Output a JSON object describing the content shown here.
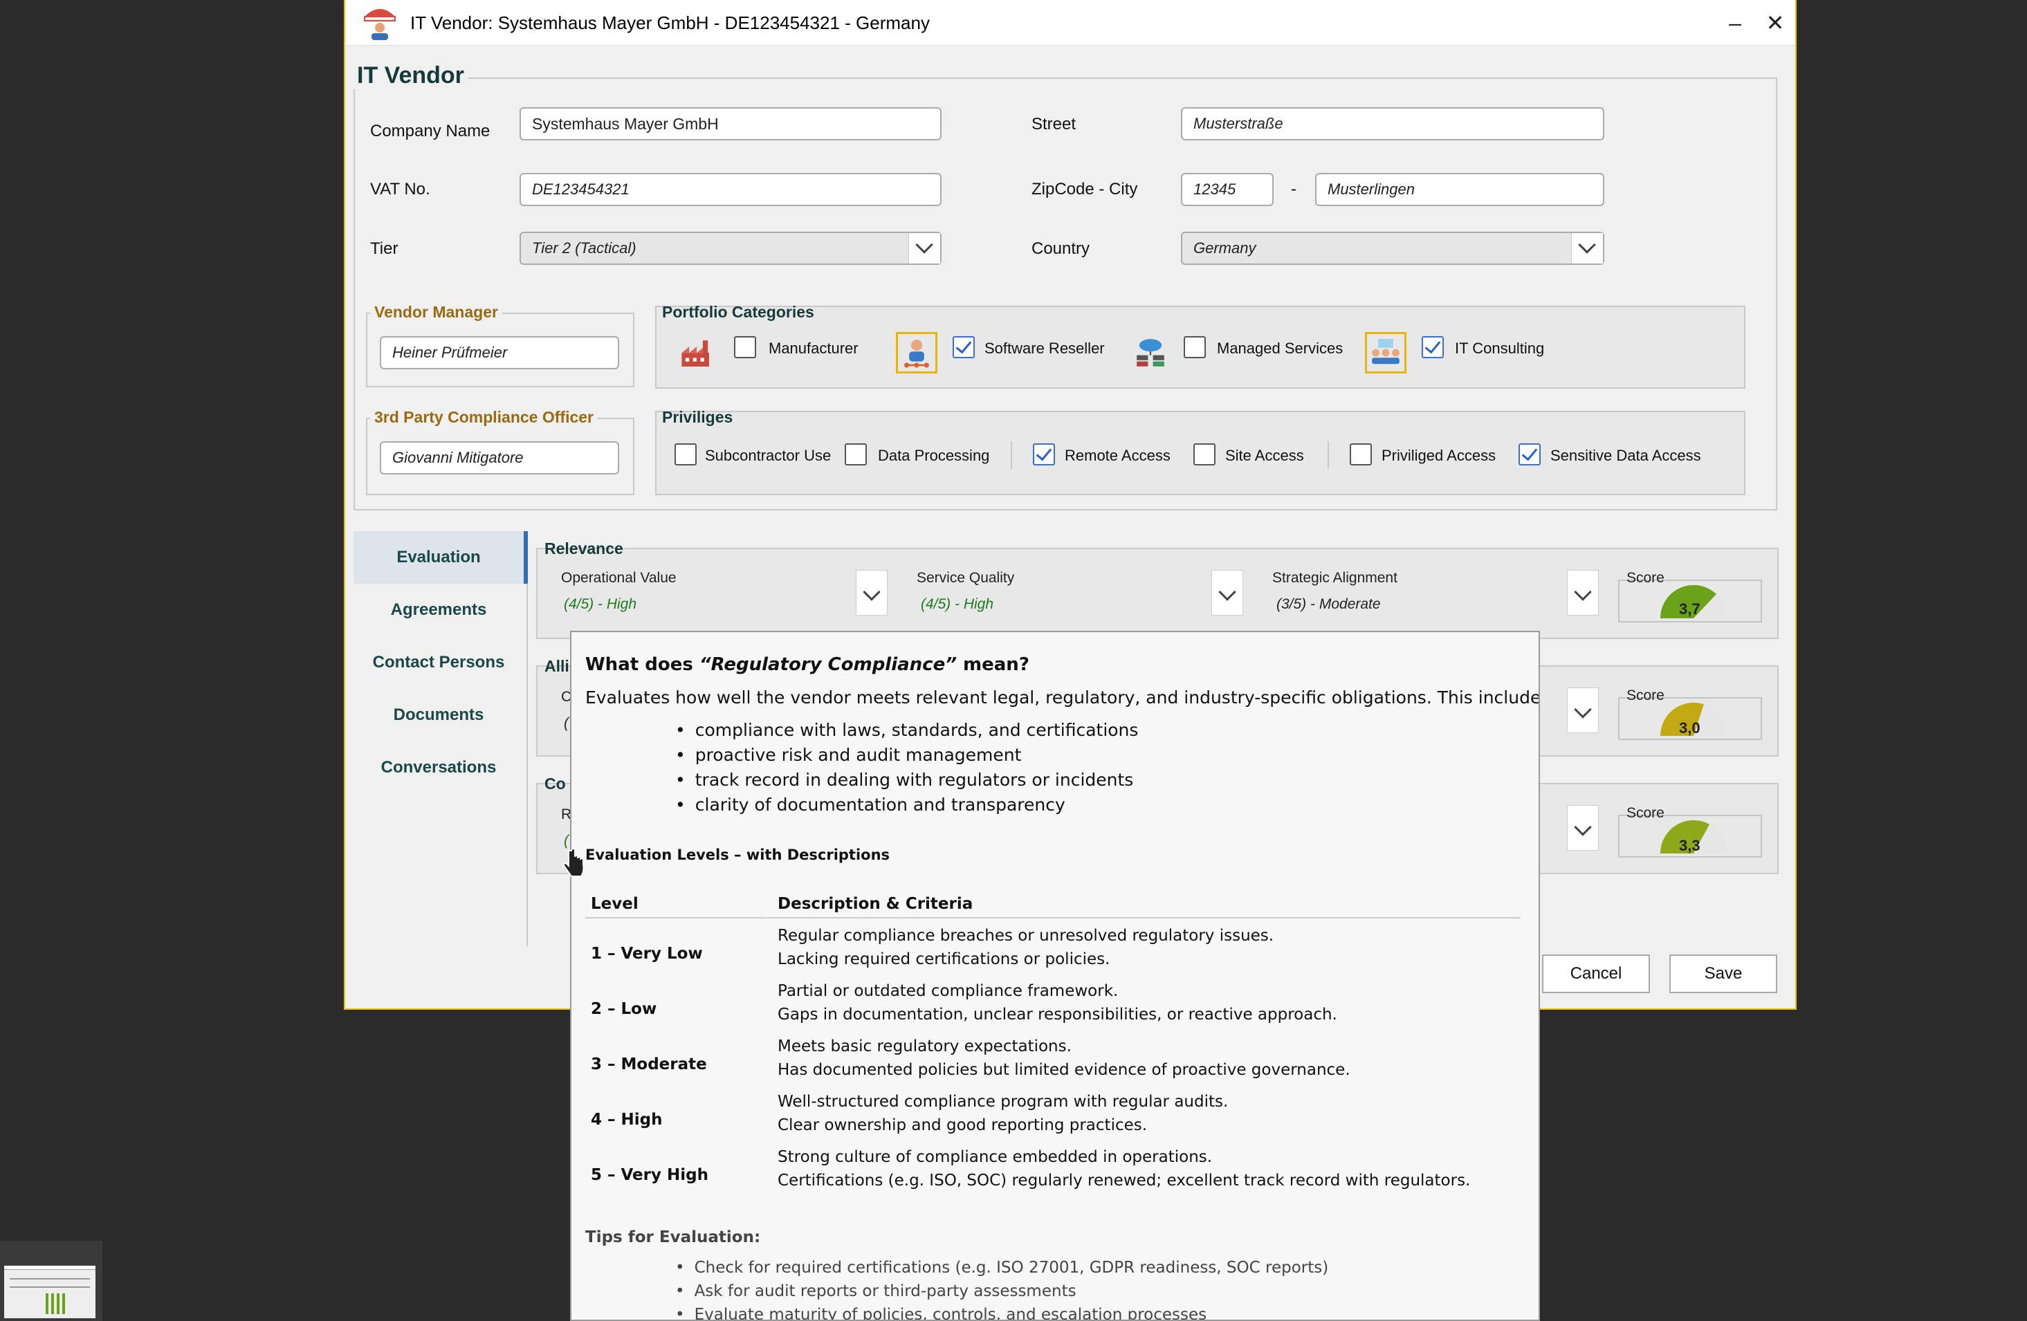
{
  "window": {
    "title": "IT Vendor: Systemhaus Mayer GmbH  - DE123454321  - Germany",
    "minimize_glyph": "–",
    "close_glyph": "✕"
  },
  "vendor": {
    "section_title": "IT Vendor",
    "company_name_label": "Company Name",
    "company_name": "Systemhaus Mayer GmbH",
    "vat_label": "VAT No.",
    "vat": "DE123454321",
    "tier_label": "Tier",
    "tier": "Tier 2 (Tactical)",
    "street_label": "Street",
    "street": "Musterstraße",
    "zip_label": "ZipCode - City",
    "zip": "12345",
    "zip_sep": "-",
    "city": "Musterlingen",
    "country_label": "Country",
    "country": "Germany"
  },
  "vendor_manager": {
    "title": "Vendor Manager",
    "value": "Heiner Prüfmeier"
  },
  "compliance_officer": {
    "title": "3rd Party Compliance Officer",
    "value": "Giovanni Mitigatore"
  },
  "portfolio": {
    "title": "Portfolio Categories",
    "items": [
      {
        "label": "Manufacturer",
        "checked": false,
        "icon": "factory-icon"
      },
      {
        "label": "Software Reseller",
        "checked": true,
        "icon": "reseller-icon"
      },
      {
        "label": "Managed Services",
        "checked": false,
        "icon": "cloud-server-icon"
      },
      {
        "label": "IT Consulting",
        "checked": true,
        "icon": "consulting-icon"
      }
    ]
  },
  "privileges": {
    "title": "Priviliges",
    "items": [
      {
        "label": "Subcontractor Use",
        "checked": false
      },
      {
        "label": "Data Processing",
        "checked": false
      },
      {
        "label": "Remote Access",
        "checked": true
      },
      {
        "label": "Site Access",
        "checked": false
      },
      {
        "label": "Priviliged Access",
        "checked": false
      },
      {
        "label": "Sensitive Data Access",
        "checked": true
      }
    ]
  },
  "tabs": [
    "Evaluation",
    "Agreements",
    "Contact Persons",
    "Documents",
    "Conversations"
  ],
  "relevance": {
    "title": "Relevance",
    "op_label": "Operational Value",
    "op_value": "(4/5) - High",
    "sq_label": "Service Quality",
    "sq_value": "(4/5) - High",
    "sa_label": "Strategic Alignment",
    "sa_value": "(3/5) - Moderate",
    "score_label": "Score",
    "score": "3,7",
    "score_level": 0.74
  },
  "section2": {
    "title_partial": "Alli",
    "c_partial": "C",
    "v_partial": "(",
    "score_label": "Score",
    "score": "3,0",
    "score_level": 0.6
  },
  "section3": {
    "title_partial": "Co",
    "c_partial": "R",
    "v_partial": "(",
    "score_label": "Score",
    "score": "3,3",
    "score_level": 0.66
  },
  "buttons": {
    "cancel": "Cancel",
    "save": "Save"
  },
  "popup": {
    "heading_pre": "What does ",
    "heading_term": "“Regulatory Compliance”",
    "heading_post": " mean?",
    "intro": "Evaluates how well the vendor meets relevant legal, regulatory, and industry-specific obligations. This includes:",
    "bullets": [
      "compliance with laws, standards, and certifications",
      "proactive risk and audit management",
      "track record in dealing with regulators or incidents",
      "clarity of documentation and transparency"
    ],
    "levels_title": "Evaluation Levels – with Descriptions",
    "col_level": "Level",
    "col_desc": "Description & Criteria",
    "levels": [
      {
        "level": "1 – Very Low",
        "l1": "Regular compliance breaches or unresolved regulatory issues.",
        "l2": "Lacking required certifications or policies."
      },
      {
        "level": "2 – Low",
        "l1": "Partial or outdated compliance framework.",
        "l2": "Gaps in documentation, unclear responsibilities, or reactive approach."
      },
      {
        "level": "3 – Moderate",
        "l1": "Meets basic regulatory expectations.",
        "l2": "Has documented policies but limited evidence of proactive governance."
      },
      {
        "level": "4 – High",
        "l1": "Well-structured compliance program with regular audits.",
        "l2": "Clear ownership and good reporting practices."
      },
      {
        "level": "5 – Very High",
        "l1": "Strong culture of compliance embedded in operations.",
        "l2": "Certifications (e.g. ISO, SOC) regularly renewed; excellent track record with regulators."
      }
    ],
    "tips_title": "Tips for Evaluation:",
    "tips": [
      "Check for required certifications (e.g. ISO 27001, GDPR readiness, SOC reports)",
      "Ask for audit reports or third-party assessments",
      "Evaluate maturity of policies, controls, and escalation processes"
    ]
  }
}
